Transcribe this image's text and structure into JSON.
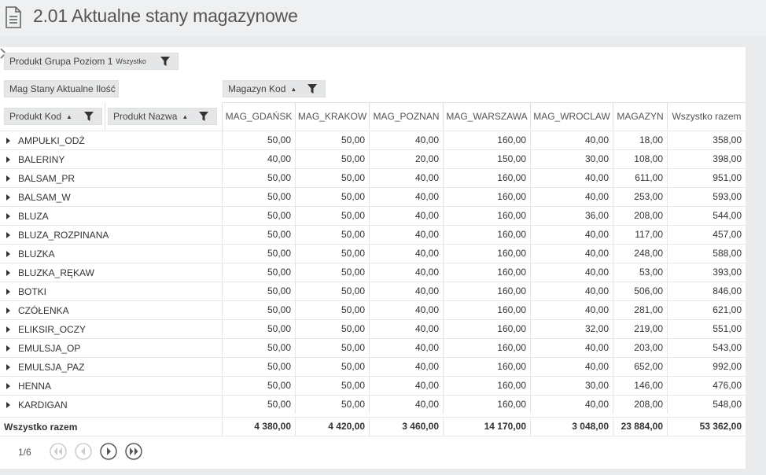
{
  "page": {
    "title": "2.01 Aktualne stany magazynowe"
  },
  "filters": {
    "group_label": "Produkt Grupa Poziom 1",
    "group_value": "Wszystko",
    "measure_label": "Mag Stany Aktualne Ilość",
    "column_field_label": "Magazyn Kod",
    "row_field_code": "Produkt Kod",
    "row_field_name": "Produkt Nazwa"
  },
  "columns": [
    "MAG_GDAŃSK",
    "MAG_KRAKOW",
    "MAG_POZNAN",
    "MAG_WARSZAWA",
    "MAG_WROCLAW",
    "MAGAZYN",
    "Wszystko razem"
  ],
  "rows": [
    {
      "name": "AMPUŁKI_ODŻ",
      "values": [
        "50,00",
        "50,00",
        "40,00",
        "160,00",
        "40,00",
        "18,00",
        "358,00"
      ]
    },
    {
      "name": "BALERINY",
      "values": [
        "40,00",
        "50,00",
        "20,00",
        "150,00",
        "30,00",
        "108,00",
        "398,00"
      ]
    },
    {
      "name": "BALSAM_PR",
      "values": [
        "50,00",
        "50,00",
        "40,00",
        "160,00",
        "40,00",
        "611,00",
        "951,00"
      ]
    },
    {
      "name": "BALSAM_W",
      "values": [
        "50,00",
        "50,00",
        "40,00",
        "160,00",
        "40,00",
        "253,00",
        "593,00"
      ]
    },
    {
      "name": "BLUZA",
      "values": [
        "50,00",
        "50,00",
        "40,00",
        "160,00",
        "36,00",
        "208,00",
        "544,00"
      ]
    },
    {
      "name": "BLUZA_ROZPINANA",
      "values": [
        "50,00",
        "50,00",
        "40,00",
        "160,00",
        "40,00",
        "117,00",
        "457,00"
      ]
    },
    {
      "name": "BLUZKA",
      "values": [
        "50,00",
        "50,00",
        "40,00",
        "160,00",
        "40,00",
        "248,00",
        "588,00"
      ]
    },
    {
      "name": "BLUZKA_RĘKAW",
      "values": [
        "50,00",
        "50,00",
        "40,00",
        "160,00",
        "40,00",
        "53,00",
        "393,00"
      ]
    },
    {
      "name": "BOTKI",
      "values": [
        "50,00",
        "50,00",
        "40,00",
        "160,00",
        "40,00",
        "506,00",
        "846,00"
      ]
    },
    {
      "name": "CZÓŁENKA",
      "values": [
        "50,00",
        "50,00",
        "40,00",
        "160,00",
        "40,00",
        "281,00",
        "621,00"
      ]
    },
    {
      "name": "ELIKSIR_OCZY",
      "values": [
        "50,00",
        "50,00",
        "40,00",
        "160,00",
        "32,00",
        "219,00",
        "551,00"
      ]
    },
    {
      "name": "EMULSJA_OP",
      "values": [
        "50,00",
        "50,00",
        "40,00",
        "160,00",
        "40,00",
        "203,00",
        "543,00"
      ]
    },
    {
      "name": "EMULSJA_PAZ",
      "values": [
        "50,00",
        "50,00",
        "40,00",
        "160,00",
        "40,00",
        "652,00",
        "992,00"
      ]
    },
    {
      "name": "HENNA",
      "values": [
        "50,00",
        "50,00",
        "40,00",
        "160,00",
        "30,00",
        "146,00",
        "476,00"
      ]
    },
    {
      "name": "KARDIGAN",
      "values": [
        "50,00",
        "50,00",
        "40,00",
        "160,00",
        "40,00",
        "208,00",
        "548,00"
      ]
    }
  ],
  "total": {
    "name": "Wszystko razem",
    "values": [
      "4 380,00",
      "4 420,00",
      "3 460,00",
      "14 170,00",
      "3 048,00",
      "23 884,00",
      "53 362,00"
    ]
  },
  "pager": {
    "text": "1/6"
  },
  "icons": {
    "doc": "document-icon",
    "filter": "filter-icon",
    "sort": "sort-ascending-icon",
    "expand": "expand-arrow-icon"
  }
}
